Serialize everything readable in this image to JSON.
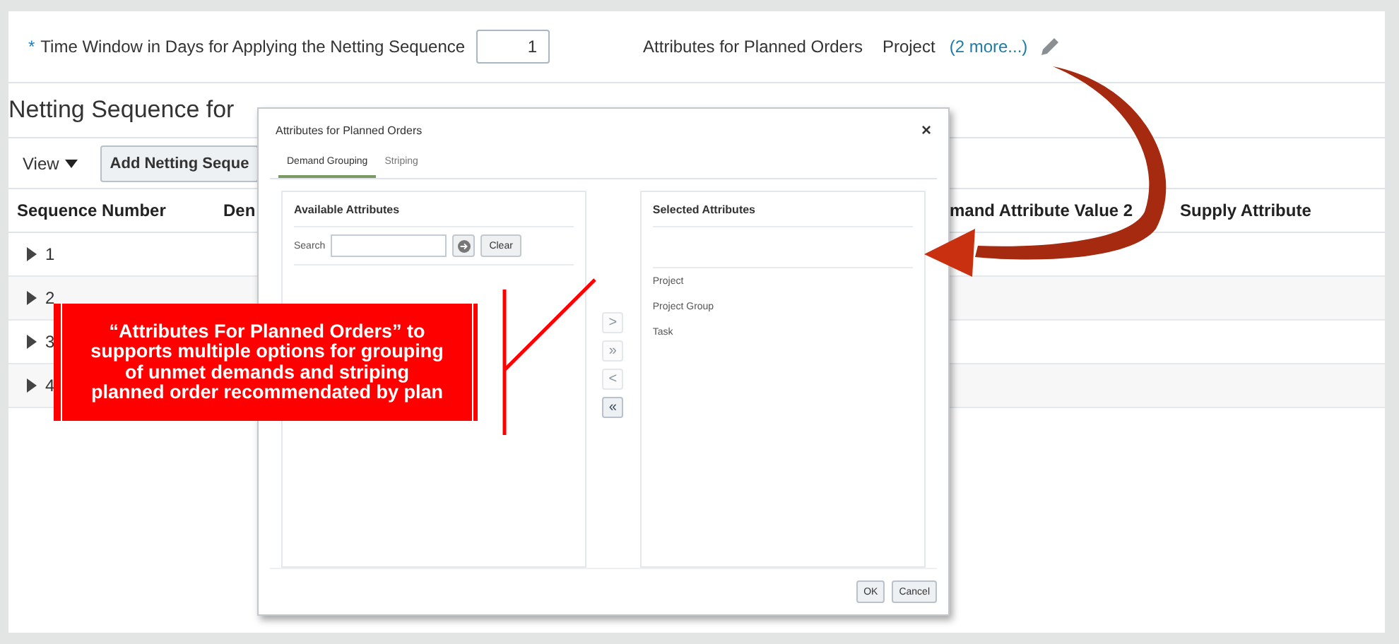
{
  "form": {
    "required_mark": "*",
    "time_window_label": "Time Window in Days for Applying the Netting Sequence",
    "time_window_value": "1",
    "attributes_label": "Attributes for Planned Orders",
    "attributes_value": "Project",
    "more_link": "(2 more...)"
  },
  "section_title": "Netting Sequence for",
  "toolbar": {
    "view_menu": "View",
    "add_button": "Add Netting Seque"
  },
  "table": {
    "columns": [
      "Sequence Number",
      "Den",
      "mand Attribute Value 2",
      "Supply Attribute"
    ],
    "rows": [
      {
        "number": "1",
        "expanded": false
      },
      {
        "number": "2",
        "expanded": false
      },
      {
        "number": "3",
        "expanded": false
      },
      {
        "number": "4",
        "expanded": false
      }
    ]
  },
  "dialog": {
    "title": "Attributes for Planned Orders",
    "close": "×",
    "tabs": [
      {
        "label": "Demand Grouping",
        "selected": true
      },
      {
        "label": "Striping",
        "selected": false
      }
    ],
    "available": {
      "title": "Available Attributes",
      "search_label": "Search",
      "clear_button": "Clear"
    },
    "shuttle": [
      {
        "label": ">",
        "disabled": true
      },
      {
        "label": "»",
        "disabled": true
      },
      {
        "label": "<",
        "disabled": true
      },
      {
        "label": "«",
        "disabled": false
      }
    ],
    "selected": {
      "title": "Selected Attributes",
      "items": [
        "Project",
        "Project Group",
        "Task"
      ]
    },
    "buttons": [
      "OK",
      "Cancel"
    ]
  },
  "callout": {
    "text": "“Attributes For Planned Orders” to supports multiple options for grouping of unmet demands and striping planned order recommendated by plan"
  }
}
